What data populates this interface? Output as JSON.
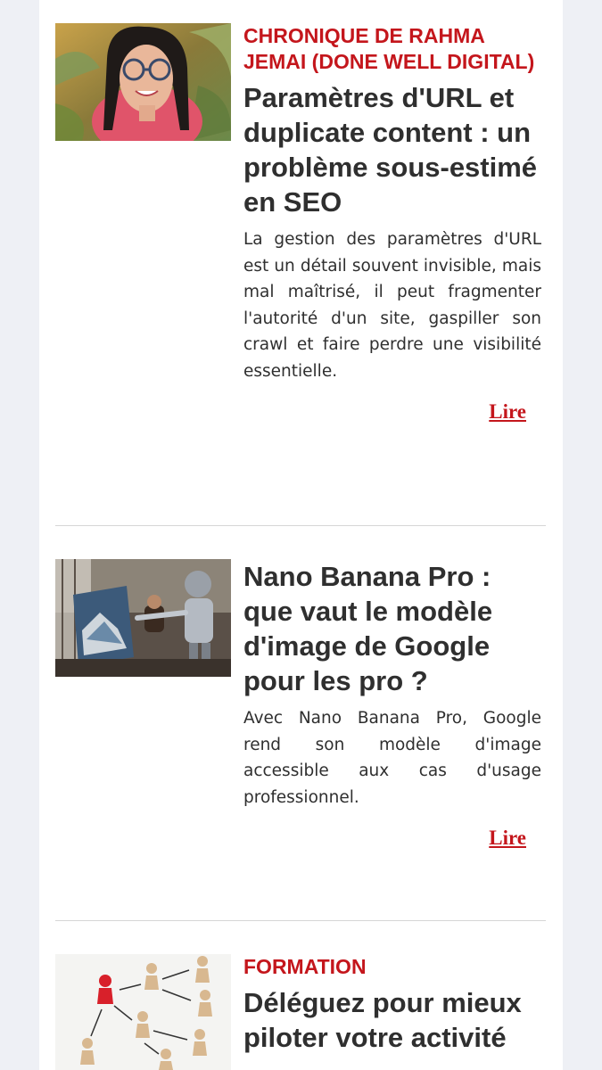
{
  "articles": [
    {
      "category": "CHRONIQUE DE RAHMA JEMAI (DONE WELL DIGITAL)",
      "title": "Paramètres d'URL et duplicate content : un problème sous-estimé en SEO",
      "excerpt": "La gestion des paramètres d'URL est un détail souvent invisible, mais mal maîtrisé, il peut fragmenter l'autorité d'un site, gaspiller son crawl et faire perdre une visibilité essentielle.",
      "read_label": "Lire"
    },
    {
      "category": "",
      "title": "Nano Banana Pro : que vaut le modèle d'image de Google pour les pro ?",
      "excerpt": "Avec Nano Banana Pro, Google rend son modèle d'image accessible aux cas d'usage professionnel.",
      "read_label": "Lire"
    },
    {
      "category": "FORMATION",
      "title": "Déléguez pour mieux piloter votre activité",
      "excerpt": "",
      "read_label": ""
    }
  ],
  "colors": {
    "accent": "#c4161c",
    "text": "#2f2f2f",
    "divider": "#d6d6d6",
    "background": "#eef0f5"
  }
}
